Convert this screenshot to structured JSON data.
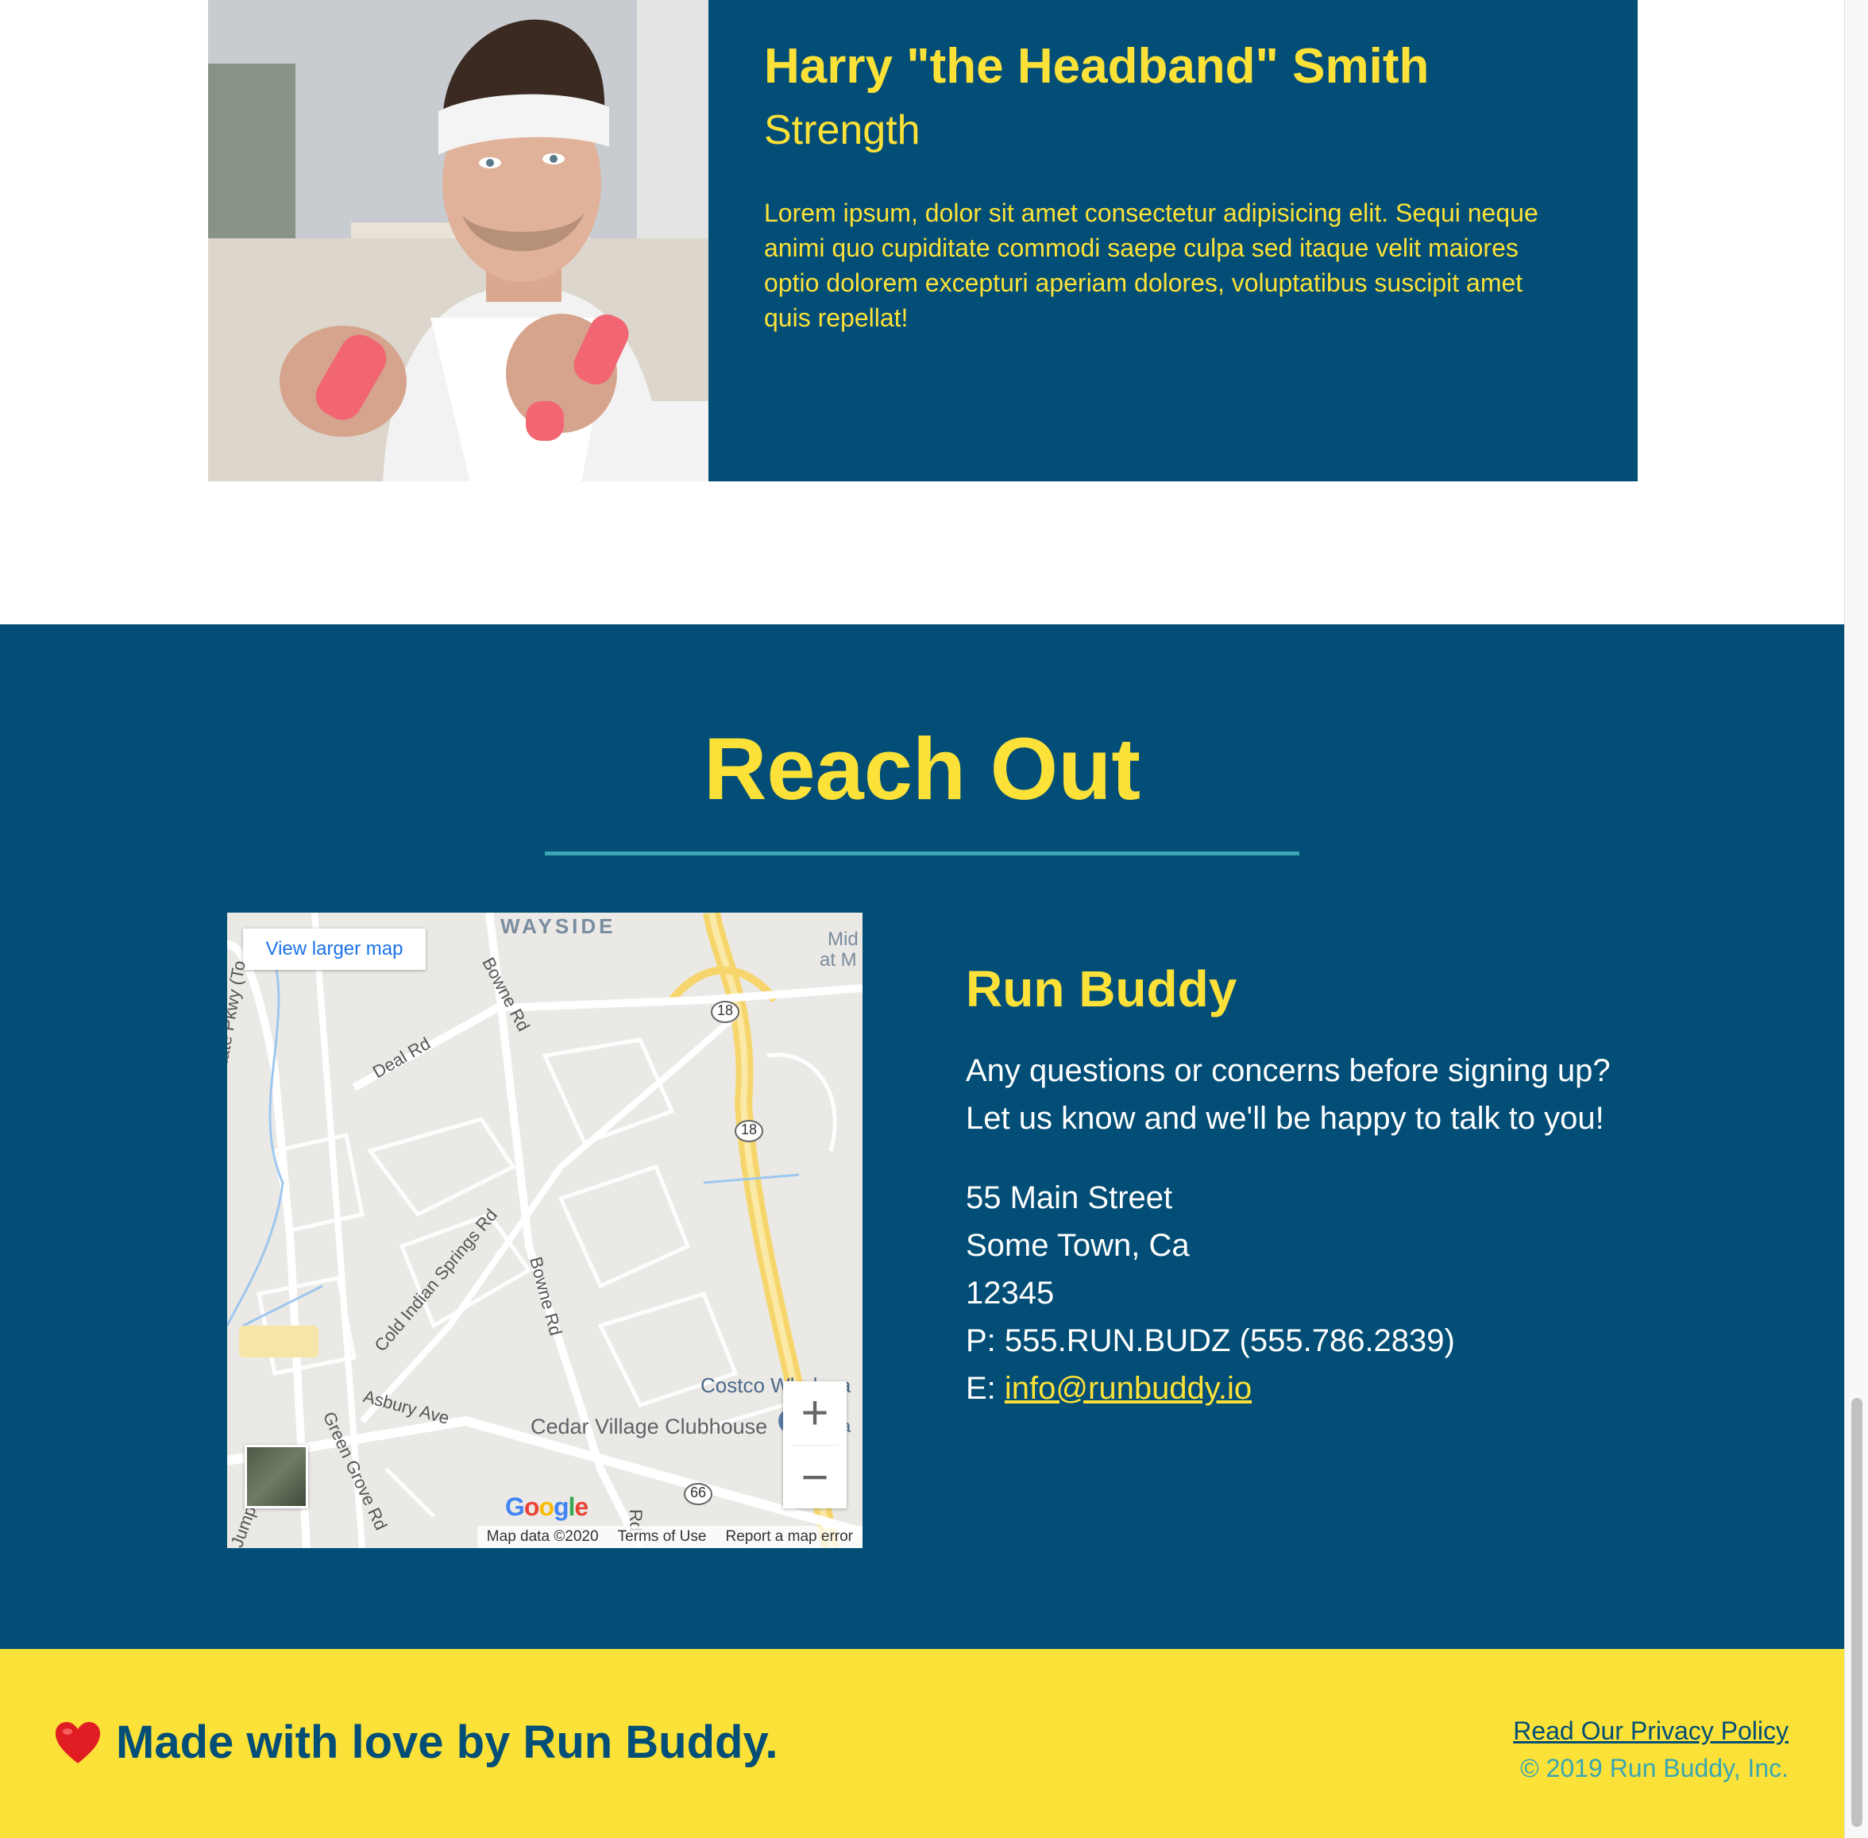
{
  "trainer": {
    "name": "Harry \"the Headband\" Smith",
    "role": "Strength",
    "bio": "Lorem ipsum, dolor sit amet consectetur adipisicing elit. Sequi neque animi quo cupiditate commodi saepe culpa sed itaque velit maiores optio dolorem excepturi aperiam dolores, voluptatibus suscipit amet quis repellat!"
  },
  "contact": {
    "title": "Reach Out",
    "brand": "Run Buddy",
    "blurb_line1": "Any questions or concerns before signing up?",
    "blurb_line2": "Let us know and we'll be happy to talk to you!",
    "address_line1": "55 Main Street",
    "address_line2": "Some Town, Ca",
    "zip": "12345",
    "phone": "P: 555.RUN.BUDZ (555.786.2839)",
    "email_prefix": "E: ",
    "email": "info@runbuddy.io"
  },
  "map": {
    "view_larger": "View larger map",
    "labels": {
      "wayside": "WAYSIDE",
      "deal_rd": "Deal Rd",
      "bowne_rd_top": "Bowne Rd",
      "bowne_rd_mid": "Bowne Rd",
      "cold_indian": "Cold Indian Springs Rd",
      "asbury": "Asbury Ave",
      "green_grove": "Green Grove Rd",
      "state_pkwy": "State Pkwy (To",
      "costco": "Costco Wholesa",
      "cedar_village": "Cedar Village Clubhouse",
      "mid": "Mid",
      "at_m": "at M",
      "jump": "Jump",
      "rd": "Rd",
      "route_18a": "18",
      "route_18b": "18",
      "route_66": "66",
      "ta": "Ta"
    },
    "google": "Google",
    "footer_data": "Map data ©2020",
    "footer_terms": "Terms of Use",
    "footer_report": "Report a map error",
    "zoom_in": "+",
    "zoom_out": "−"
  },
  "footer": {
    "made_with": "Made with love by Run Buddy.",
    "privacy": "Read Our Privacy Policy",
    "copyright": "© 2019 Run Buddy, Inc."
  },
  "colors": {
    "primary": "#024e76",
    "accent": "#fce138",
    "secondary": "#39a6b2"
  },
  "icons": {
    "heart": "heart-icon",
    "satellite": "satellite-thumbnail-icon"
  }
}
